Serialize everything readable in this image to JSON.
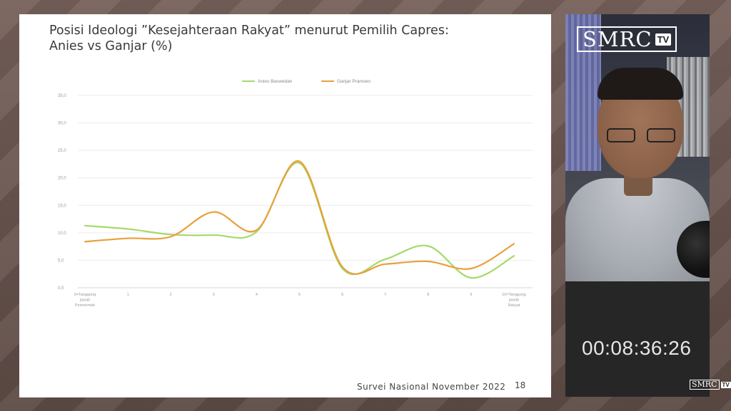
{
  "slide": {
    "title_line1": "Posisi Ideologi ”Kesejahteraan Rakyat” menurut Pemilih Capres:",
    "title_line2": "Anies vs Ganjar (%)",
    "source": "Survei Nasional November 2022",
    "page_number": "18"
  },
  "broadcast": {
    "logo_text": "SMRC",
    "logo_badge": "TV",
    "timer": "00:08:36:26",
    "small_logo_text": "SMRC",
    "small_logo_badge": "TV"
  },
  "chart_data": {
    "type": "line",
    "title": "",
    "xlabel": "",
    "ylabel": "",
    "categories": [
      "0=Tanggung jawab Pemerintah",
      "1",
      "2",
      "3",
      "4",
      "5",
      "6",
      "7",
      "8",
      "9",
      "10=Tanggung jawab Rakyat"
    ],
    "category_lines": [
      [
        "0=Tanggung",
        "jawab",
        "Pemerintah"
      ],
      [
        "1"
      ],
      [
        "2"
      ],
      [
        "3"
      ],
      [
        "4"
      ],
      [
        "5"
      ],
      [
        "6"
      ],
      [
        "7"
      ],
      [
        "8"
      ],
      [
        "9"
      ],
      [
        "10=Tanggung",
        "jawab",
        "Rakyat"
      ]
    ],
    "yticks": [
      "0,0",
      "5,0",
      "10,0",
      "15,0",
      "20,0",
      "25,0",
      "30,0",
      "35,0"
    ],
    "ylim": [
      0,
      35
    ],
    "grid": true,
    "legend_position": "top-center",
    "series": [
      {
        "name": "Anies Baswedan",
        "color": "#a6d96a",
        "values": [
          11.3,
          10.7,
          9.7,
          9.6,
          10.2,
          22.7,
          3.5,
          5.2,
          7.6,
          1.8,
          5.8
        ]
      },
      {
        "name": "Ganjar Pranowo",
        "color": "#e8a03c",
        "values": [
          8.4,
          9.0,
          9.3,
          13.8,
          10.5,
          23.0,
          3.8,
          4.3,
          4.8,
          3.5,
          8.0
        ]
      }
    ]
  }
}
